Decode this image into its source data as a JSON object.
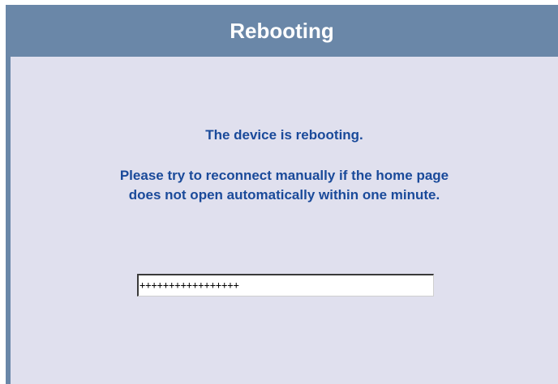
{
  "header": {
    "title": "Rebooting"
  },
  "message": {
    "line1": "The device is rebooting.",
    "line2a": "Please try to reconnect manually if the home page",
    "line2b": "does not open automatically within one minute."
  },
  "progress": {
    "text": "+++++++++++++++++"
  },
  "colors": {
    "header_bg": "#6a87a8",
    "panel_bg": "#e0e0ee",
    "text": "#1a4a9a"
  }
}
